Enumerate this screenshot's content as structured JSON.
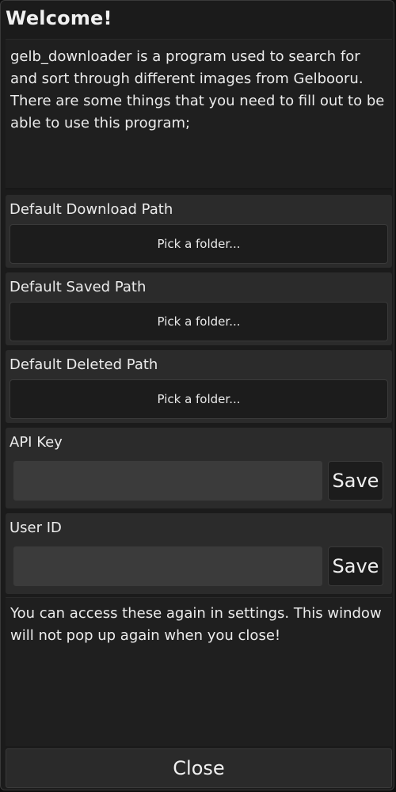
{
  "window": {
    "title": "Welcome!",
    "intro_text": "gelb_downloader is a program used to search for and sort through different images from Gelbooru. There are some things that you need to fill out to be able to use this program;"
  },
  "paths": {
    "download": {
      "label": "Default Download Path",
      "button": "Pick a folder..."
    },
    "saved": {
      "label": "Default Saved Path",
      "button": "Pick a folder..."
    },
    "deleted": {
      "label": "Default Deleted Path",
      "button": "Pick a folder..."
    }
  },
  "api_key": {
    "label": "API Key",
    "value": "",
    "save_label": "Save"
  },
  "user_id": {
    "label": "User ID",
    "value": "",
    "save_label": "Save"
  },
  "footer": {
    "note": "You can access these again in settings. This window will not pop up again when you close!",
    "close_label": "Close"
  },
  "colors": {
    "window_bg": "#1b1b1b",
    "section_bg": "#2b2b2b",
    "button_bg": "#1c1c1c",
    "input_bg": "#3b3b3b",
    "text": "#ececec"
  }
}
